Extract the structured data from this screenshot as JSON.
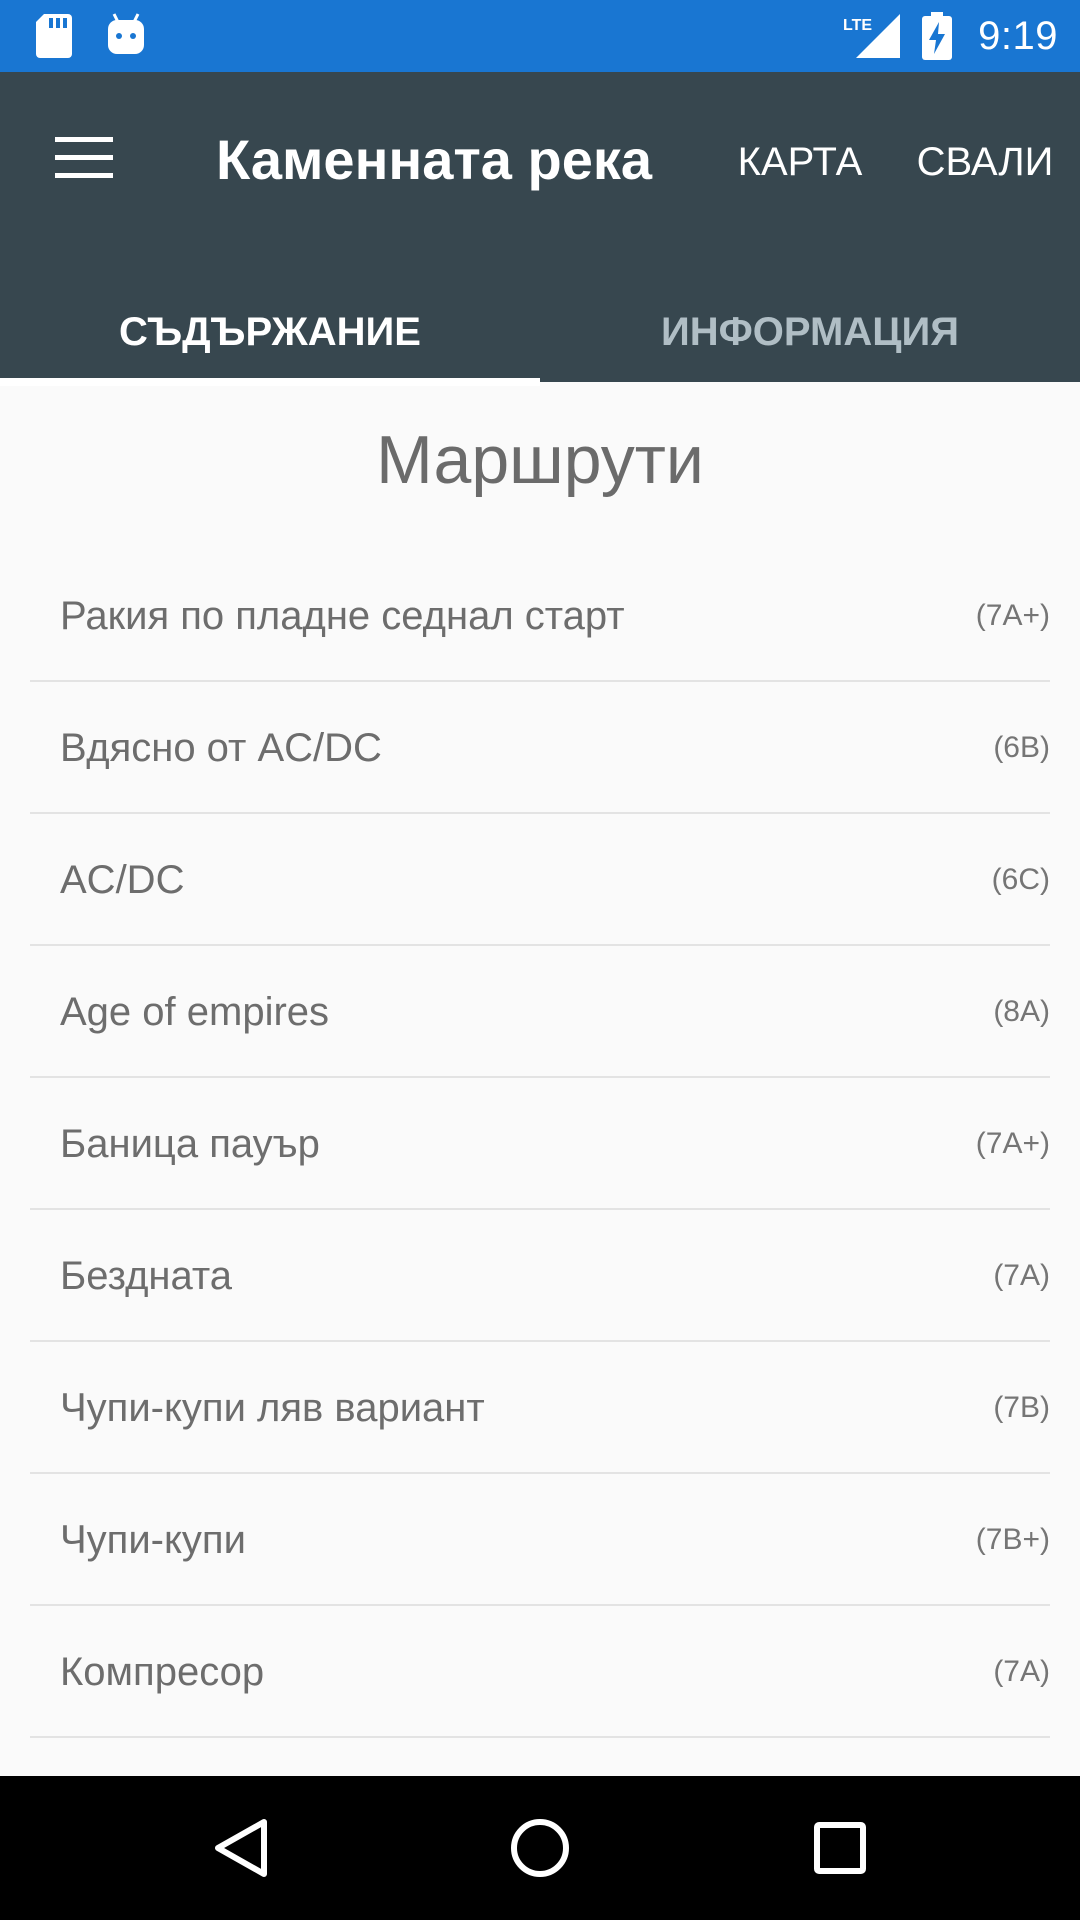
{
  "status_bar": {
    "time": "9:19",
    "network_label": "LTE",
    "icons": [
      "sd-card-icon",
      "android-debug-icon",
      "lte-signal-icon",
      "battery-charging-icon"
    ],
    "background_color": "#1976d2"
  },
  "app_bar": {
    "title": "Каменната река",
    "menu_icon": "hamburger-menu-icon",
    "actions": {
      "map": "КАРТА",
      "download": "СВАЛИ"
    },
    "background_color": "#37474f"
  },
  "tabs": [
    {
      "label": "СЪДЪРЖАНИЕ",
      "selected": true
    },
    {
      "label": "ИНФОРМАЦИЯ",
      "selected": false
    }
  ],
  "section": {
    "title": "Маршрути"
  },
  "routes": [
    {
      "name": "Ракия по пладне седнал старт",
      "grade": "(7A+)"
    },
    {
      "name": "Вдясно от AC/DC",
      "grade": "(6B)"
    },
    {
      "name": "AC/DC",
      "grade": "(6C)"
    },
    {
      "name": "Age of empires",
      "grade": "(8A)"
    },
    {
      "name": "Баница пауър",
      "grade": "(7A+)"
    },
    {
      "name": "Бездната",
      "grade": "(7A)"
    },
    {
      "name": "Чупи-купи ляв вариант",
      "grade": "(7B)"
    },
    {
      "name": "Чупи-купи",
      "grade": "(7B+)"
    },
    {
      "name": "Компресор",
      "grade": "(7A)"
    }
  ],
  "nav_bar": {
    "icons": [
      "back-triangle-icon",
      "home-circle-icon",
      "recents-square-icon"
    ]
  }
}
